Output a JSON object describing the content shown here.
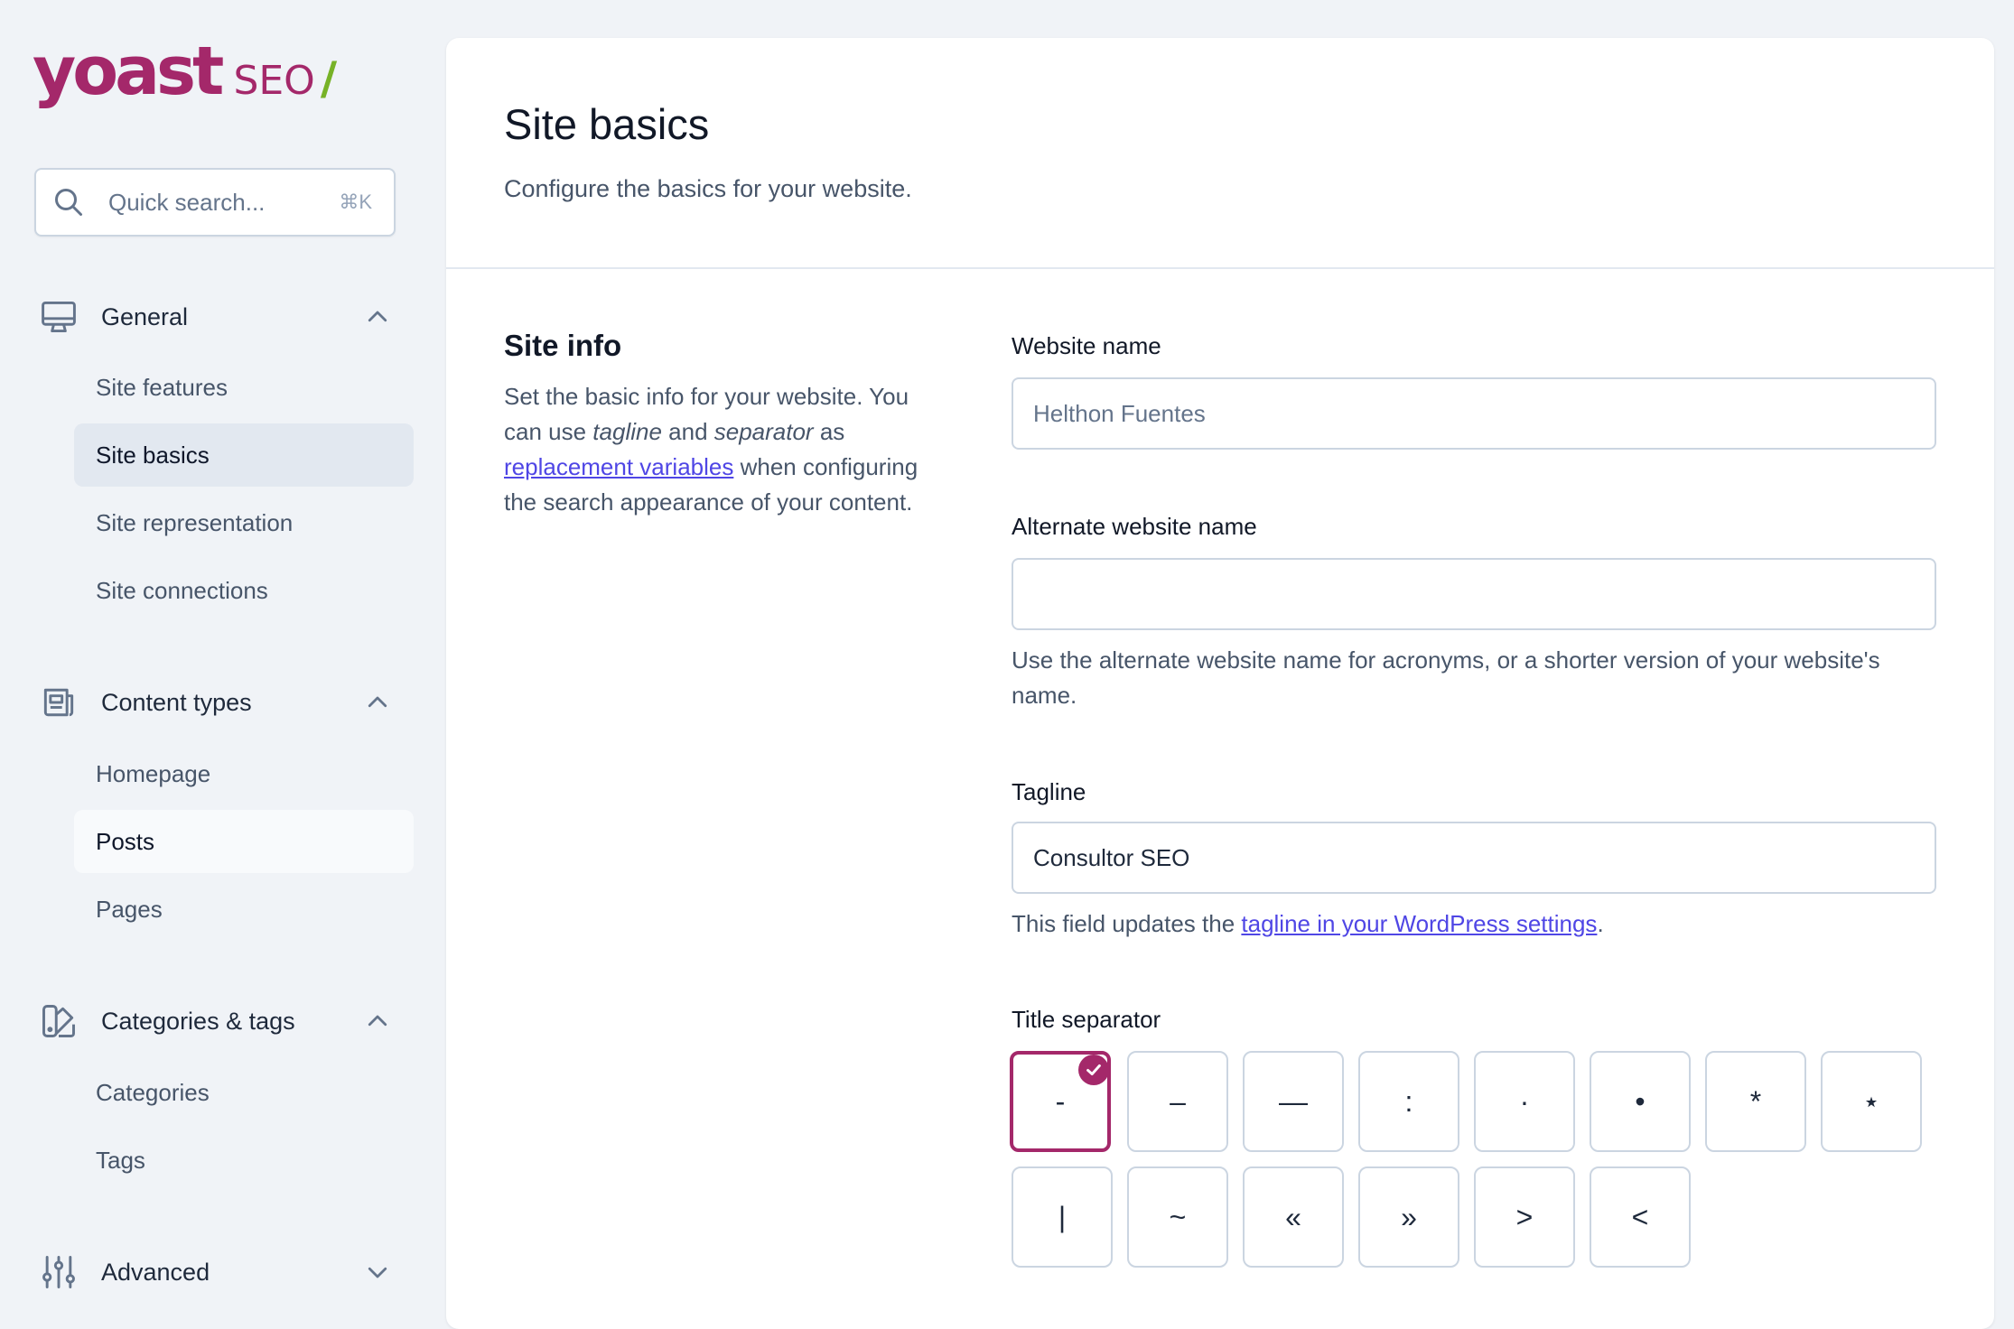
{
  "brand": {
    "logo_word": "yoast",
    "logo_seo": "SEO",
    "logo_slash": "/",
    "accent": "#a4286a",
    "green": "#77b227"
  },
  "search": {
    "placeholder": "Quick search...",
    "shortcut": "⌘K",
    "icon": "search-icon"
  },
  "sidebar": {
    "groups": [
      {
        "label": "General",
        "icon": "monitor-icon",
        "expanded": true,
        "items": [
          {
            "label": "Site features"
          },
          {
            "label": "Site basics",
            "active": true
          },
          {
            "label": "Site representation"
          },
          {
            "label": "Site connections"
          }
        ]
      },
      {
        "label": "Content types",
        "icon": "newspaper-icon",
        "expanded": true,
        "items": [
          {
            "label": "Homepage"
          },
          {
            "label": "Posts"
          },
          {
            "label": "Pages"
          }
        ]
      },
      {
        "label": "Categories & tags",
        "icon": "color-swatch-icon",
        "expanded": true,
        "items": [
          {
            "label": "Categories"
          },
          {
            "label": "Tags"
          }
        ]
      },
      {
        "label": "Advanced",
        "icon": "adjustments-icon",
        "expanded": false,
        "items": []
      }
    ]
  },
  "main": {
    "title": "Site basics",
    "description": "Configure the basics for your website.",
    "section": {
      "title": "Site info",
      "desc_part1": "Set the basic info for your website. You can use ",
      "desc_tagline": "tagline",
      "desc_and": " and ",
      "desc_separator": "separator",
      "desc_as": " as ",
      "desc_link": "replacement variables",
      "desc_part2": " when configuring the search appearance of your content."
    },
    "fields": {
      "website_name": {
        "label": "Website name",
        "placeholder": "Helthon Fuentes",
        "value": ""
      },
      "alternate_name": {
        "label": "Alternate website name",
        "placeholder": "",
        "value": "",
        "help": "Use the alternate website name for acronyms, or a shorter version of your website's name."
      },
      "tagline": {
        "label": "Tagline",
        "value": "Consultor SEO",
        "help_prefix": "This field updates the ",
        "help_link": "tagline in your WordPress settings",
        "help_suffix": "."
      },
      "title_separator": {
        "label": "Title separator",
        "options": [
          "-",
          "–",
          "—",
          ":",
          "·",
          "•",
          "*",
          "⋆",
          "|",
          "~",
          "«",
          "»",
          ">",
          "<"
        ],
        "selected": "-"
      }
    }
  }
}
